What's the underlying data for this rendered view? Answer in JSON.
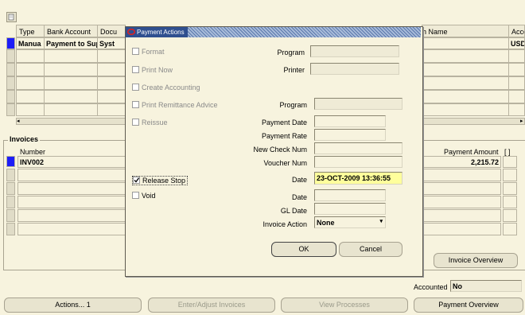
{
  "background_table": {
    "headers": {
      "type": "Type",
      "bank_account": "Bank Account",
      "doc": "Docu",
      "payee": "h Name",
      "currency": "Acco"
    },
    "row": {
      "type": "Manua",
      "bank_account": "Payment to Supp",
      "doc": "Syst",
      "currency": "USD"
    }
  },
  "invoices": {
    "section_title": "Invoices",
    "number_header": "Number",
    "payment_amount_header": "Payment Amount",
    "bracket_header": "[ ]",
    "row": {
      "number": "INV002",
      "amount": "2,215.72"
    }
  },
  "buttons": {
    "invoice_overview": "Invoice Overview",
    "actions": "Actions... 1",
    "enter_adjust": "Enter/Adjust Invoices",
    "view_processes": "View Processes",
    "payment_overview": "Payment Overview"
  },
  "accounted": {
    "label": "Accounted",
    "value": "No"
  },
  "dialog": {
    "title": "Payment Actions",
    "format": "Format",
    "print_now": "Print Now",
    "create_accounting": "Create Accounting",
    "print_remittance": "Print Remittance Advice",
    "reissue": "Reissue",
    "release_stop": "Release Stop",
    "void": "Void",
    "program_label": "Program",
    "printer_label": "Printer",
    "program2_label": "Program",
    "payment_date_label": "Payment Date",
    "payment_rate_label": "Payment Rate",
    "new_check_label": "New Check Num",
    "voucher_label": "Voucher Num",
    "date_label": "Date",
    "date_value": "23-OCT-2009 13:36:55",
    "void_date_label": "Date",
    "gl_date_label": "GL Date",
    "invoice_action_label": "Invoice Action",
    "invoice_action_value": "None",
    "ok": "OK",
    "cancel": "Cancel"
  }
}
